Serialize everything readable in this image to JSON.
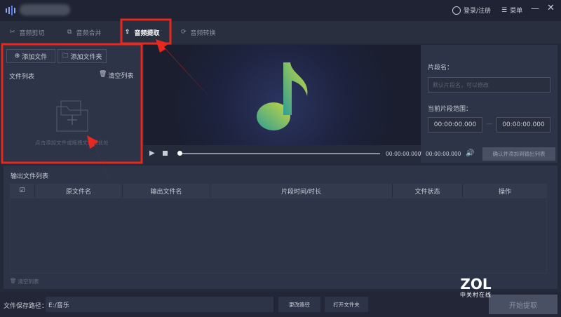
{
  "titlebar": {
    "login": "登录/注册",
    "menu": "菜单"
  },
  "tabs": [
    {
      "label": "音频剪切",
      "icon": "scissors-icon"
    },
    {
      "label": "音频合并",
      "icon": "merge-icon"
    },
    {
      "label": "音频提取",
      "icon": "extract-icon",
      "active": true
    },
    {
      "label": "音频转换",
      "icon": "convert-icon"
    }
  ],
  "left": {
    "add_file": "添加文件",
    "add_folder": "添加文件夹",
    "list_title": "文件列表",
    "clear_list": "清空列表",
    "drop_hint": "点击添加文件或拖拽文件至此处"
  },
  "player": {
    "current": "00:00:00.000",
    "sep": "/",
    "total": "00:00:00.000",
    "progress": 0
  },
  "right": {
    "segment_name_label": "片段名：",
    "segment_name_placeholder": "默认片段名，可以修改",
    "range_label": "当前片段范围：",
    "start": "00:00:00.000",
    "dash": "—",
    "end": "00:00:00.000",
    "confirm": "确认并添加到输出列表"
  },
  "output": {
    "title": "输出文件列表",
    "columns": [
      "原文件名",
      "输出文件名",
      "片段时间/时长",
      "文件状态",
      "操作"
    ],
    "clear": "清空列表"
  },
  "bottom": {
    "path_label": "文件保存路径：",
    "path_value": "E:/音乐",
    "change_path": "更改路径",
    "open_folder": "打开文件夹",
    "start": "开始提取"
  },
  "watermark": {
    "logo": "ZOL",
    "sub": "中关村在线"
  },
  "colors": {
    "annotation": "#e8281e",
    "accent_green": "#3fb58a"
  }
}
